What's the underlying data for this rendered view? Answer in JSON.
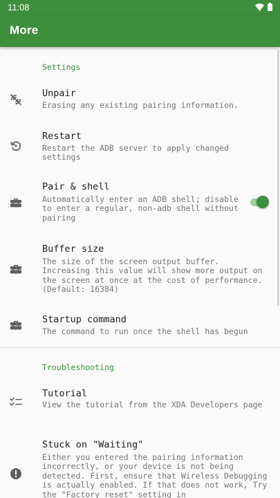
{
  "status_bar": {
    "time": "11:08",
    "icons": [
      "wifi-icon",
      "battery-icon"
    ]
  },
  "app_bar": {
    "title": "More",
    "color": "#3d8f3d"
  },
  "sections": {
    "settings": {
      "header": "Settings",
      "items": {
        "unpair": {
          "title": "Unpair",
          "summary": "Erasing any existing pairing information.",
          "icon": "unpair-icon"
        },
        "restart": {
          "title": "Restart",
          "summary": "Restart the ADB server to apply changed settings",
          "icon": "restart-icon"
        },
        "pair_shell": {
          "title": "Pair & shell",
          "summary": "Automatically enter an ADB shell; disable to enter a regular, non-adb shell without pairing",
          "icon": "toolbox-icon",
          "toggle_on": true
        },
        "buffer_size": {
          "title": "Buffer size",
          "summary": "The size of the screen output buffer. Increasing this value will show more output on the screen at once at the cost of performance. (Default: 16384)",
          "icon": "toolbox-icon"
        },
        "startup_command": {
          "title": "Startup command",
          "summary": "The command to run once the shell has begun",
          "icon": "toolbox-icon"
        }
      }
    },
    "troubleshooting": {
      "header": "Troubleshooting",
      "items": {
        "tutorial": {
          "title": "Tutorial",
          "summary": "View the tutorial from the XDA Developers page",
          "icon": "checklist-icon"
        },
        "stuck_waiting": {
          "title": "Stuck on \"Waiting\"",
          "summary": "Either you entered the pairing information incorrectly, or your device is not being detected. First, ensure that Wireless Debugging is actually enabled. If that does not work, Try the \"Factory reset\" setting in",
          "icon": "alert-icon"
        }
      }
    }
  }
}
